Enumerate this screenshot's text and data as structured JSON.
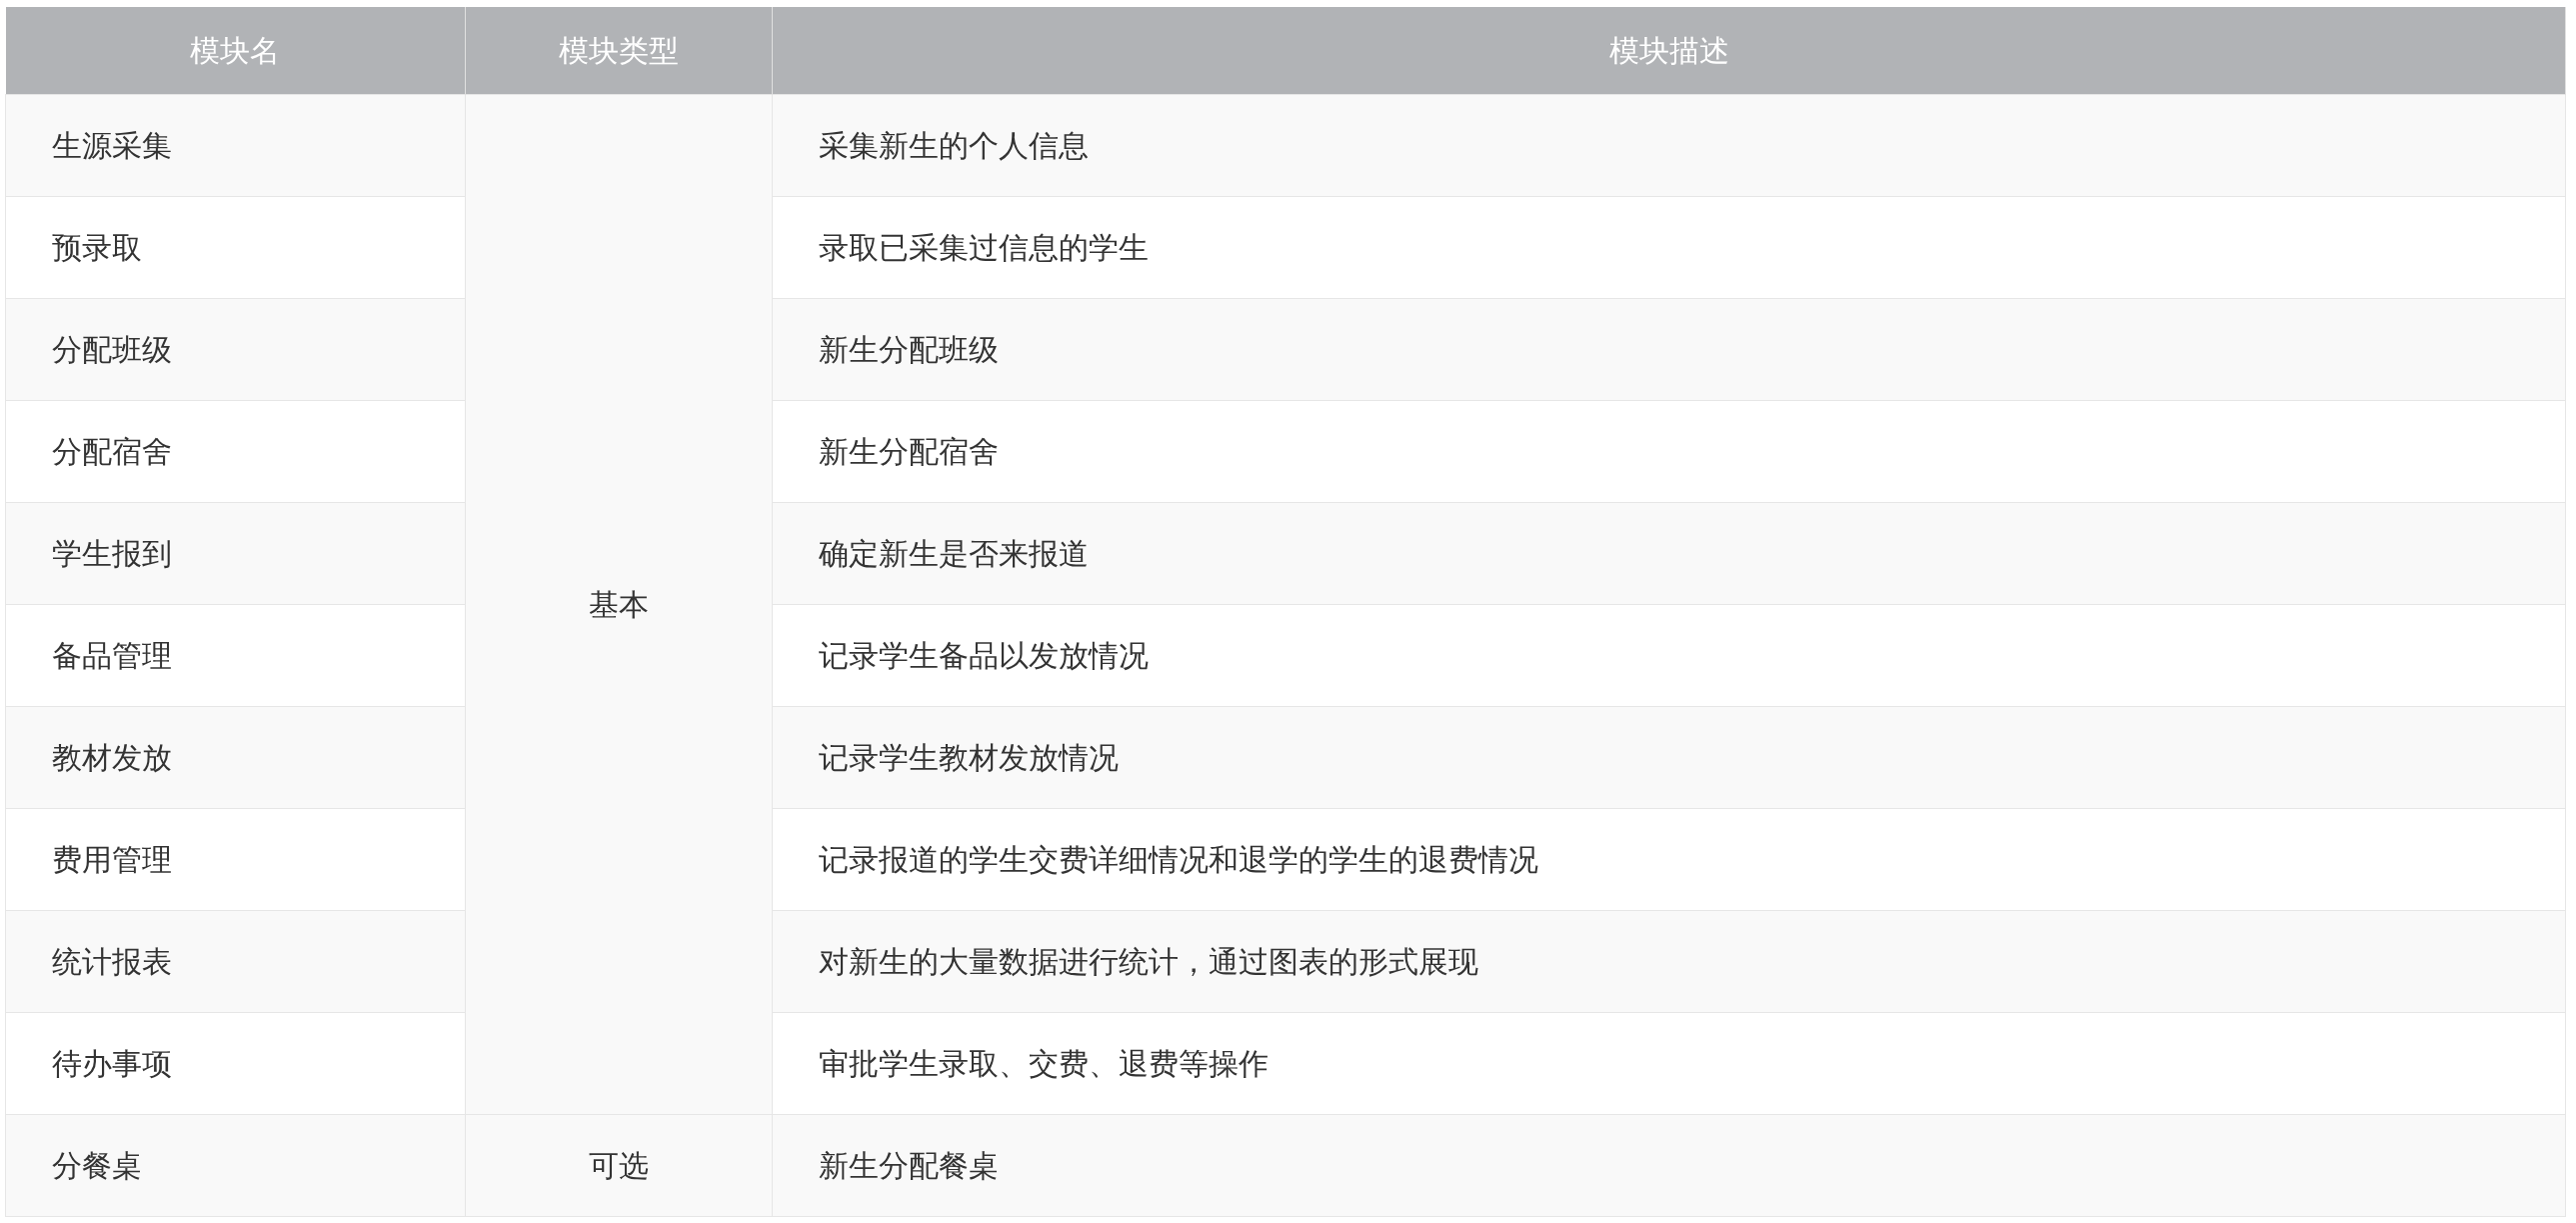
{
  "table": {
    "columns": [
      "模块名",
      "模块类型",
      "模块描述"
    ],
    "groups": [
      {
        "type": "基本",
        "modules": [
          {
            "name": "生源采集",
            "description": "采集新生的个人信息"
          },
          {
            "name": "预录取",
            "description": "录取已采集过信息的学生"
          },
          {
            "name": "分配班级",
            "description": "新生分配班级"
          },
          {
            "name": "分配宿舍",
            "description": "新生分配宿舍"
          },
          {
            "name": "学生报到",
            "description": "确定新生是否来报道"
          },
          {
            "name": "备品管理",
            "description": "记录学生备品以发放情况"
          },
          {
            "name": "教材发放",
            "description": "记录学生教材发放情况"
          },
          {
            "name": "费用管理",
            "description": "记录报道的学生交费详细情况和退学的学生的退费情况"
          },
          {
            "name": "统计报表",
            "description": "对新生的大量数据进行统计，通过图表的形式展现"
          },
          {
            "name": "待办事项",
            "description": "审批学生录取、交费、退费等操作"
          }
        ]
      },
      {
        "type": "可选",
        "modules": [
          {
            "name": "分餐桌",
            "description": "新生分配餐桌"
          }
        ]
      }
    ]
  }
}
